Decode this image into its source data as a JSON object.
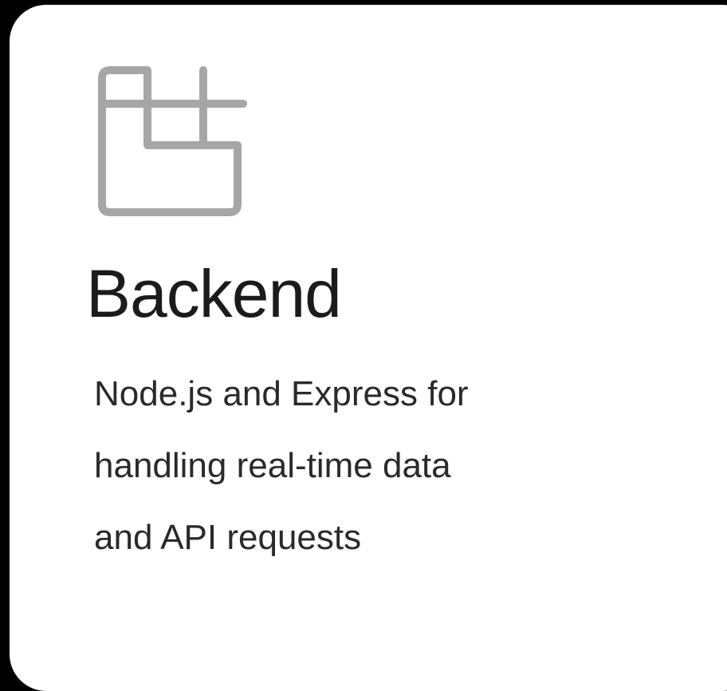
{
  "card": {
    "icon": "layout-grid-icon",
    "title": "Backend",
    "description_lines": [
      "Node.js and Express for",
      "handling real-time data",
      "and API requests"
    ]
  },
  "colors": {
    "background": "#000000",
    "card": "#ffffff",
    "icon": "#a6a6a6",
    "title": "#1b1b1b",
    "text": "#2a2a2a"
  }
}
